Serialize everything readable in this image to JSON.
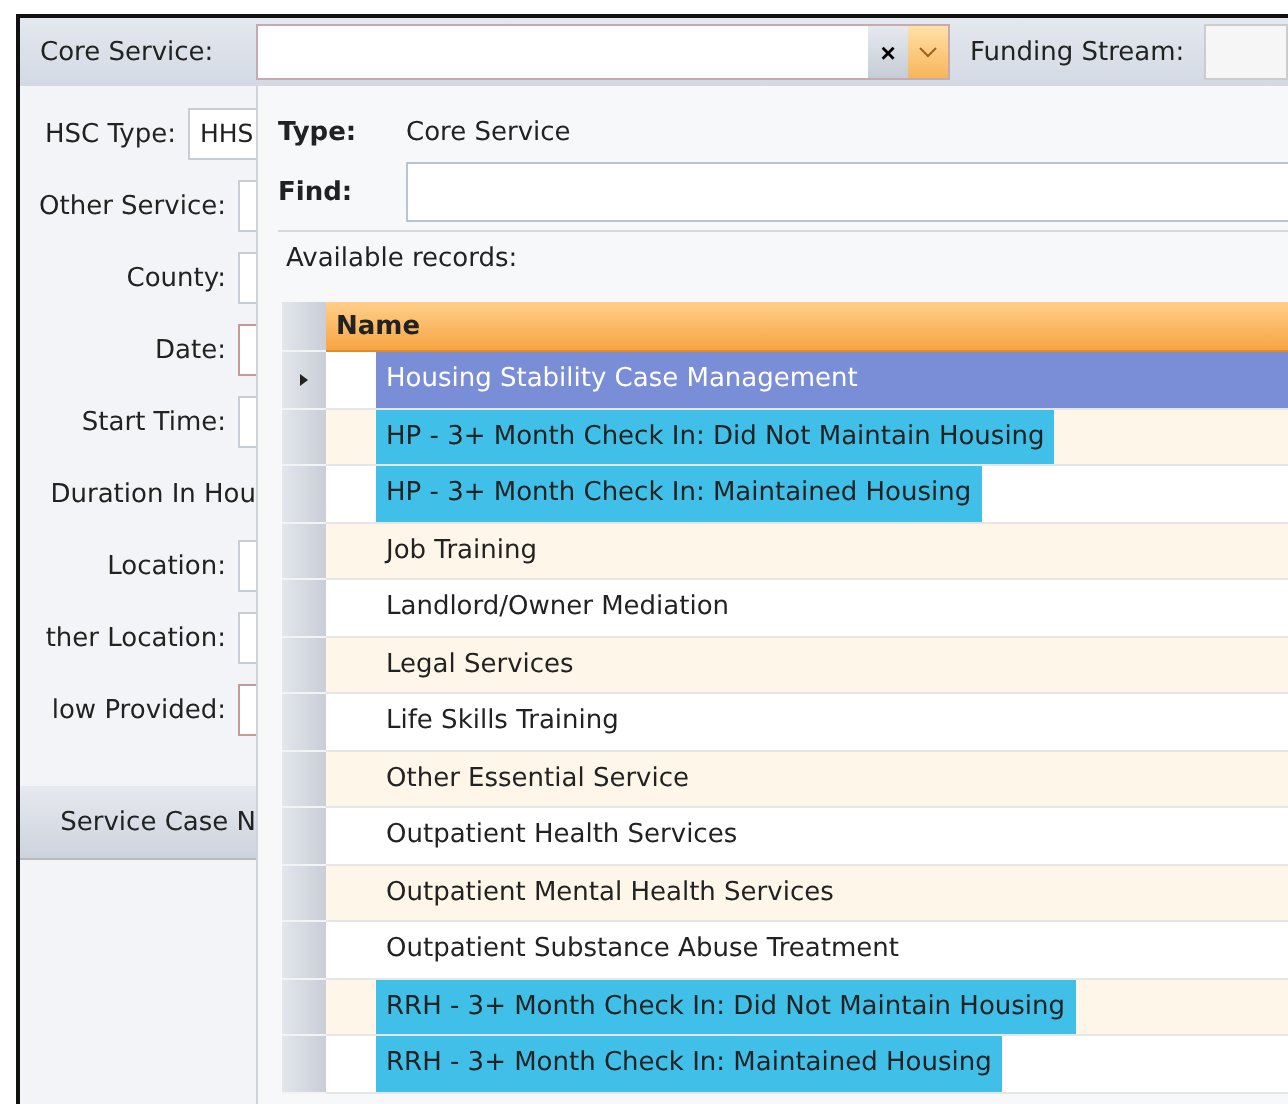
{
  "top_bar": {
    "core_service": {
      "label": "Core Service:",
      "clear": "×"
    },
    "funding_stream": {
      "label": "Funding Stream:"
    }
  },
  "form": {
    "fields": [
      {
        "label": "HSC Type:",
        "value": "HHS",
        "required": false
      },
      {
        "label": "Other Service:",
        "required": false
      },
      {
        "label": "County:",
        "required": false
      },
      {
        "label": "Date:",
        "required": true
      },
      {
        "label": "Start Time:",
        "required": false
      },
      {
        "label": "Duration In Hou",
        "kind": "label_only"
      },
      {
        "label": "Location:",
        "required": false
      },
      {
        "label": "ther Location:",
        "required": false
      },
      {
        "label": "low Provided:",
        "required": true
      }
    ],
    "section": "Service Case N"
  },
  "popup": {
    "type_label": "Type:",
    "type_value": "Core Service",
    "find_label": "Find:",
    "available_label": "Available records:",
    "table": {
      "columns": [
        "Name"
      ],
      "rows": [
        {
          "name": "Housing Stability Case Management",
          "selected": true,
          "highlighted": false
        },
        {
          "name": "HP - 3+ Month Check In: Did Not Maintain Housing",
          "selected": false,
          "highlighted": true
        },
        {
          "name": "HP - 3+ Month Check In: Maintained Housing",
          "selected": false,
          "highlighted": true
        },
        {
          "name": "Job Training",
          "selected": false,
          "highlighted": false
        },
        {
          "name": "Landlord/Owner Mediation",
          "selected": false,
          "highlighted": false
        },
        {
          "name": "Legal Services",
          "selected": false,
          "highlighted": false
        },
        {
          "name": "Life Skills Training",
          "selected": false,
          "highlighted": false
        },
        {
          "name": "Other Essential Service",
          "selected": false,
          "highlighted": false
        },
        {
          "name": "Outpatient Health Services",
          "selected": false,
          "highlighted": false
        },
        {
          "name": "Outpatient Mental Health Services",
          "selected": false,
          "highlighted": false
        },
        {
          "name": "Outpatient Substance Abuse Treatment",
          "selected": false,
          "highlighted": false
        },
        {
          "name": "RRH - 3+ Month Check In: Did Not Maintain Housing",
          "selected": false,
          "highlighted": true
        },
        {
          "name": "RRH - 3+ Month Check In: Maintained Housing",
          "selected": false,
          "highlighted": true
        }
      ]
    }
  }
}
